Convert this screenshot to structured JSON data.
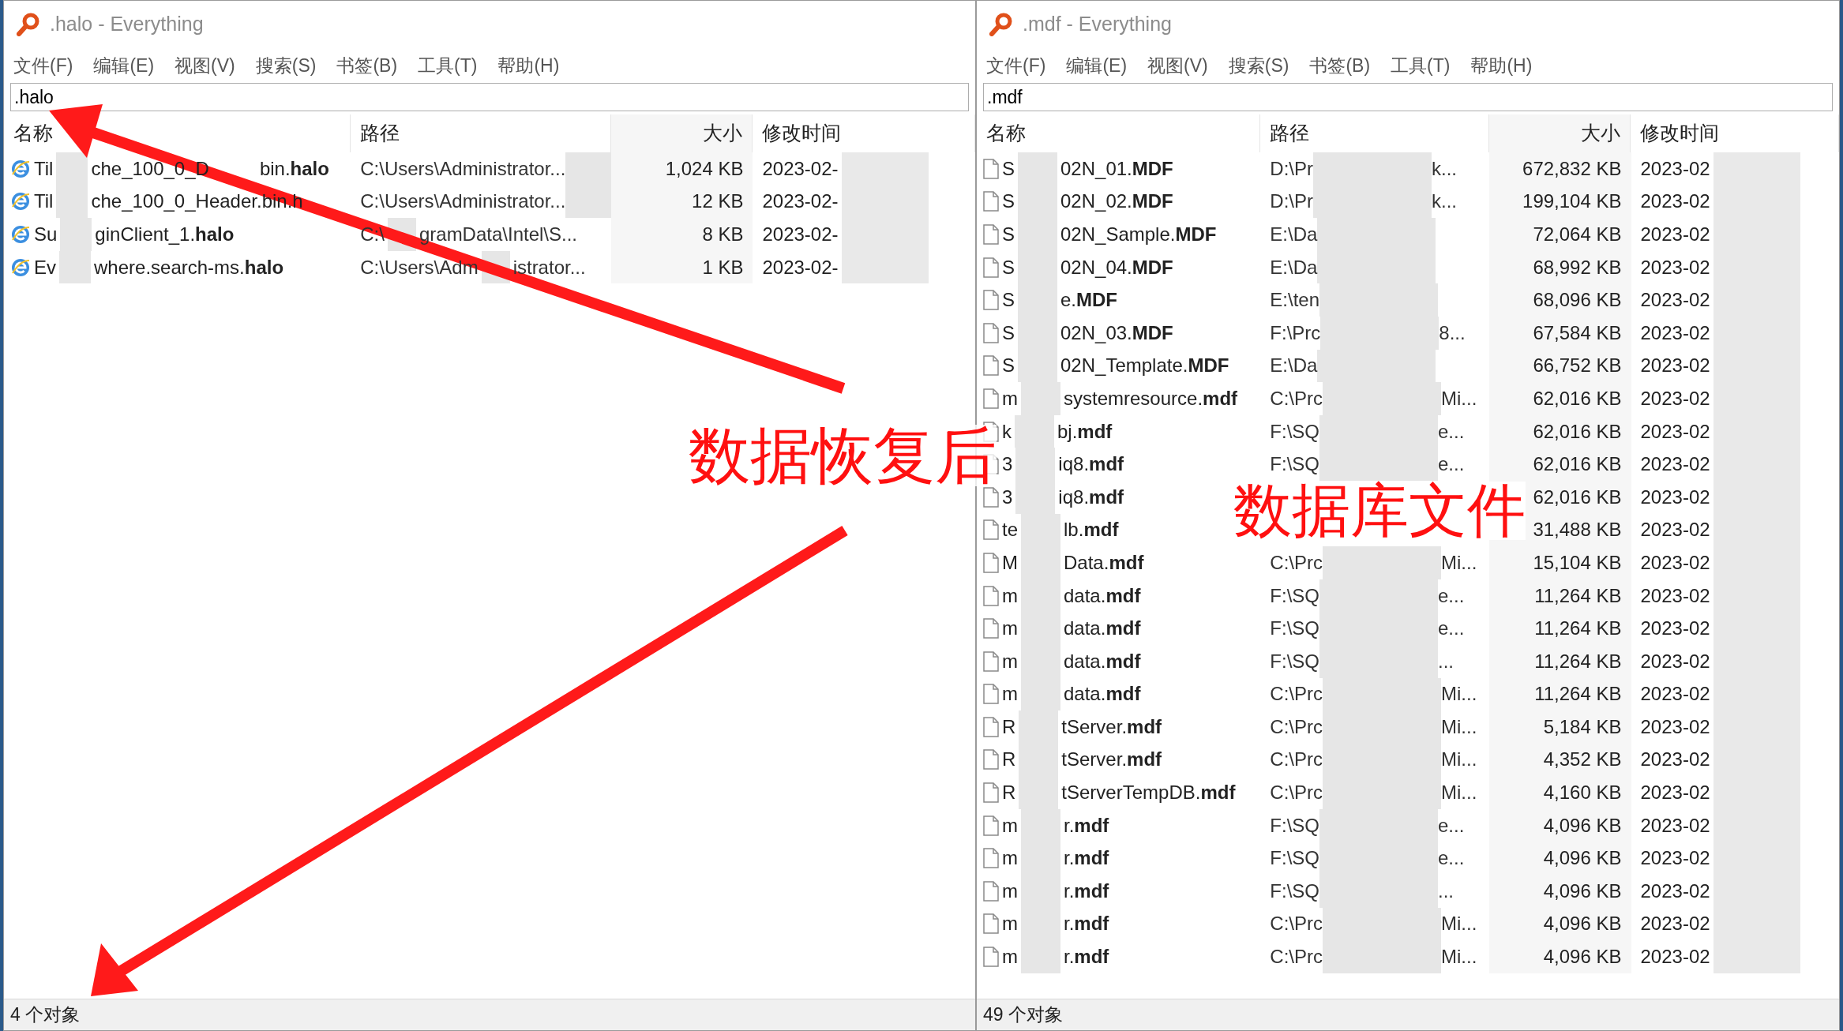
{
  "windows": [
    {
      "title": ".halo - Everything",
      "menu": [
        "文件(F)",
        "编辑(E)",
        "视图(V)",
        "搜索(S)",
        "书签(B)",
        "工具(T)",
        "帮助(H)"
      ],
      "search": {
        "value": ".halo"
      },
      "columns": [
        "名称",
        "路径",
        "大小",
        "修改时间"
      ],
      "rows": [
        {
          "kind": "app",
          "name": [
            "Til",
            "che_100_0_D",
            "bin.**halo**"
          ],
          "path": [
            "C:\\Users\\Administrator..."
          ],
          "size": "1,024 KB",
          "date": "2023-02-"
        },
        {
          "kind": "app",
          "name": [
            "Til",
            "che_100_0_Header.bin.h"
          ],
          "path": [
            "C:\\Users\\Administrator..."
          ],
          "size": "12 KB",
          "date": "2023-02-"
        },
        {
          "kind": "app",
          "name": [
            "Su",
            "ginClient_1.**halo**"
          ],
          "path": [
            "C:\\",
            "gramData\\Intel\\S..."
          ],
          "size": "8 KB",
          "date": "2023-02-"
        },
        {
          "kind": "app",
          "name": [
            "Ev",
            "where.search-ms.**halo**"
          ],
          "path": [
            "C:\\Users\\Adm",
            "istrator..."
          ],
          "size": "1 KB",
          "date": "2023-02-"
        }
      ],
      "status": "4 个对象"
    },
    {
      "title": ".mdf - Everything",
      "menu": [
        "文件(F)",
        "编辑(E)",
        "视图(V)",
        "搜索(S)",
        "书签(B)",
        "工具(T)",
        "帮助(H)"
      ],
      "search": {
        "value": ".mdf"
      },
      "columns": [
        "名称",
        "路径",
        "大小",
        "修改时间"
      ],
      "rows": [
        {
          "kind": "file",
          "name": [
            "S",
            "02N_01.**MDF**"
          ],
          "path": [
            "D:\\Pr",
            "k..."
          ],
          "size": "672,832 KB",
          "date": "2023-02"
        },
        {
          "kind": "file",
          "name": [
            "S",
            "02N_02.**MDF**"
          ],
          "path": [
            "D:\\Pr",
            "k..."
          ],
          "size": "199,104 KB",
          "date": "2023-02"
        },
        {
          "kind": "file",
          "name": [
            "S",
            "02N_Sample.**MDF**"
          ],
          "path": [
            "E:\\Da"
          ],
          "size": "72,064 KB",
          "date": "2023-02"
        },
        {
          "kind": "file",
          "name": [
            "S",
            "02N_04.**MDF**"
          ],
          "path": [
            "E:\\Da"
          ],
          "size": "68,992 KB",
          "date": "2023-02"
        },
        {
          "kind": "file",
          "name": [
            "S",
            "e.**MDF**"
          ],
          "path": [
            "E:\\ten"
          ],
          "size": "68,096 KB",
          "date": "2023-02"
        },
        {
          "kind": "file",
          "name": [
            "S",
            "02N_03.**MDF**"
          ],
          "path": [
            "F:\\Prc",
            "8..."
          ],
          "size": "67,584 KB",
          "date": "2023-02"
        },
        {
          "kind": "file",
          "name": [
            "S",
            "02N_Template.**MDF**"
          ],
          "path": [
            "E:\\Da"
          ],
          "size": "66,752 KB",
          "date": "2023-02"
        },
        {
          "kind": "file",
          "name": [
            "m",
            "systemresource.**mdf**"
          ],
          "path": [
            "C:\\Prc",
            "Mi..."
          ],
          "size": "62,016 KB",
          "date": "2023-02"
        },
        {
          "kind": "file",
          "name": [
            "k",
            "bj.**mdf**"
          ],
          "path": [
            "F:\\SQ",
            "e..."
          ],
          "size": "62,016 KB",
          "date": "2023-02"
        },
        {
          "kind": "file",
          "name": [
            "3",
            "iq8.**mdf**"
          ],
          "path": [
            "F:\\SQ",
            "e..."
          ],
          "size": "62,016 KB",
          "date": "2023-02"
        },
        {
          "kind": "file",
          "name": [
            "3",
            "iq8.**mdf**"
          ],
          "size": "62,016 KB",
          "date": "2023-02"
        },
        {
          "kind": "file",
          "name": [
            "te",
            "lb.**mdf**"
          ],
          "size": "31,488 KB",
          "date": "2023-02"
        },
        {
          "kind": "file",
          "name": [
            "M",
            "Data.**mdf**"
          ],
          "path": [
            "C:\\Prc",
            "Mi..."
          ],
          "size": "15,104 KB",
          "date": "2023-02"
        },
        {
          "kind": "file",
          "name": [
            "m",
            "data.**mdf**"
          ],
          "path": [
            "F:\\SQ",
            "e..."
          ],
          "size": "11,264 KB",
          "date": "2023-02"
        },
        {
          "kind": "file",
          "name": [
            "m",
            "data.**mdf**"
          ],
          "path": [
            "F:\\SQ",
            "e..."
          ],
          "size": "11,264 KB",
          "date": "2023-02"
        },
        {
          "kind": "file",
          "name": [
            "m",
            "data.**mdf**"
          ],
          "path": [
            "F:\\SQ",
            "..."
          ],
          "size": "11,264 KB",
          "date": "2023-02"
        },
        {
          "kind": "file",
          "name": [
            "m",
            "data.**mdf**"
          ],
          "path": [
            "C:\\Prc",
            "Mi..."
          ],
          "size": "11,264 KB",
          "date": "2023-02"
        },
        {
          "kind": "file",
          "name": [
            "R",
            "tServer.**mdf**"
          ],
          "path": [
            "C:\\Prc",
            "Mi..."
          ],
          "size": "5,184 KB",
          "date": "2023-02"
        },
        {
          "kind": "file",
          "name": [
            "R",
            "tServer.**mdf**"
          ],
          "path": [
            "C:\\Prc",
            "Mi..."
          ],
          "size": "4,352 KB",
          "date": "2023-02"
        },
        {
          "kind": "file",
          "name": [
            "R",
            "tServerTempDB.**mdf**"
          ],
          "path": [
            "C:\\Prc",
            "Mi..."
          ],
          "size": "4,160 KB",
          "date": "2023-02"
        },
        {
          "kind": "file",
          "name": [
            "m",
            "r.**mdf**"
          ],
          "path": [
            "F:\\SQ",
            "e..."
          ],
          "size": "4,096 KB",
          "date": "2023-02"
        },
        {
          "kind": "file",
          "name": [
            "m",
            "r.**mdf**"
          ],
          "path": [
            "F:\\SQ",
            "e..."
          ],
          "size": "4,096 KB",
          "date": "2023-02"
        },
        {
          "kind": "file",
          "name": [
            "m",
            "r.**mdf**"
          ],
          "path": [
            "F:\\SQ",
            "..."
          ],
          "size": "4,096 KB",
          "date": "2023-02"
        },
        {
          "kind": "file",
          "name": [
            "m",
            "r.**mdf**"
          ],
          "path": [
            "C:\\Prc",
            "Mi..."
          ],
          "size": "4,096 KB",
          "date": "2023-02"
        },
        {
          "kind": "file",
          "name": [
            "m",
            "r.**mdf**"
          ],
          "path": [
            "C:\\Prc",
            "Mi..."
          ],
          "size": "4,096 KB",
          "date": "2023-02"
        }
      ],
      "status": "49 个对象"
    }
  ],
  "annotations": [
    "数据恢复后",
    "数据库文件"
  ]
}
